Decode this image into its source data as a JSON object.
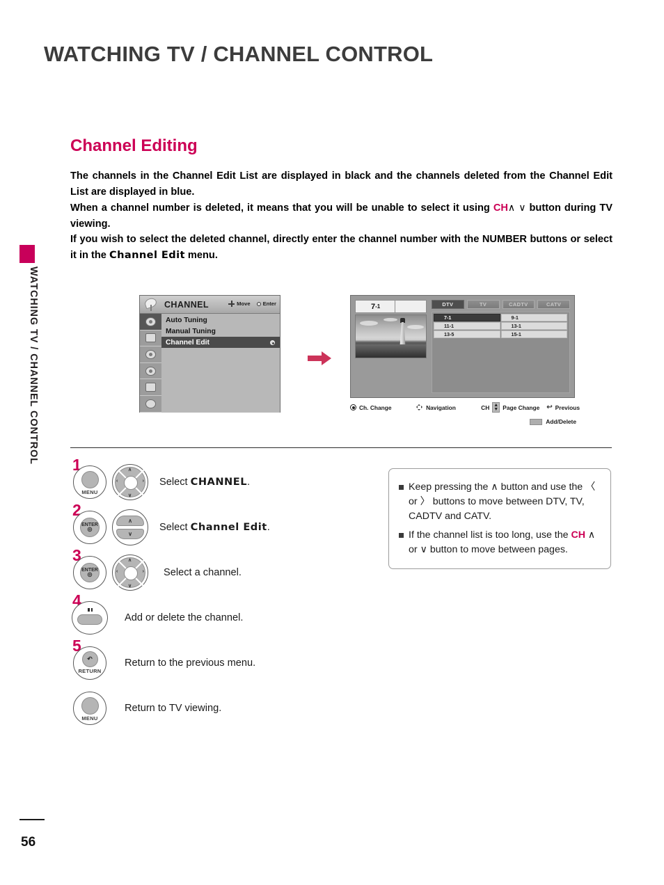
{
  "page": {
    "title": "WATCHING TV / CHANNEL CONTROL",
    "side_tab_text": "WATCHING TV / CHANNEL CONTROL",
    "number": "56",
    "accent_color": "#cc0055"
  },
  "section": {
    "heading": "Channel Editing",
    "paragraphs": {
      "p1_a": "The channels in the Channel Edit List are displayed in black and the channels deleted from the Channel Edit List are displayed in blue.",
      "p2_a": "When a channel number is deleted, it means that you will be unable to select it using ",
      "p2_ch": "CH",
      "p2_up": "∧",
      "p2_down": "∨",
      "p2_b": " button during TV viewing.",
      "p3_a": "If you wish to select the deleted channel, directly enter the channel number with the NUMBER buttons or select it in the ",
      "p3_emph": "Channel Edit",
      "p3_b": " menu."
    }
  },
  "osd_left": {
    "icon_name": "satellite-dish-icon",
    "title": "CHANNEL",
    "hint_move": "Move",
    "hint_enter": "Enter",
    "rail_icons": [
      "picture-icon",
      "screen-icon",
      "audio-icon",
      "time-icon",
      "option-icon",
      "lock-icon"
    ],
    "menu_items": [
      {
        "label": "Auto Tuning",
        "selected": false
      },
      {
        "label": "Manual Tuning",
        "selected": false
      },
      {
        "label": "Channel Edit",
        "selected": true
      }
    ]
  },
  "osd_right": {
    "preview_channel_major": "7",
    "preview_channel_minor": "-1",
    "tabs": [
      {
        "label": "DTV",
        "active": true
      },
      {
        "label": "TV",
        "active": false
      },
      {
        "label": "CADTV",
        "active": false
      },
      {
        "label": "CATV",
        "active": false
      }
    ],
    "channel_rows": [
      [
        {
          "label": "7-1",
          "highlight": true
        },
        {
          "label": "9-1",
          "highlight": false
        }
      ],
      [
        {
          "label": "11-1",
          "highlight": false
        },
        {
          "label": "13-1",
          "highlight": false
        }
      ],
      [
        {
          "label": "13-5",
          "highlight": false
        },
        {
          "label": "15-1",
          "highlight": false
        }
      ]
    ],
    "legend": [
      {
        "label": "Ch. Change",
        "icon": "enter-dot-icon"
      },
      {
        "label": "Navigation",
        "icon": "four-way-arrows-icon"
      },
      {
        "label": "Page Change",
        "icon": "ch-updown-icon",
        "prefix": "CH"
      },
      {
        "label": "Previous",
        "icon": "return-arrow-icon"
      }
    ],
    "legend_add_delete": "Add/Delete"
  },
  "steps": [
    {
      "number": "1",
      "buttons": [
        "menu-button",
        "four-way-wheel"
      ],
      "text_before": "Select ",
      "text_emph": "CHANNEL",
      "text_after": ".",
      "button_labels": {
        "primary": "MENU",
        "primary_cap": ""
      }
    },
    {
      "number": "2",
      "buttons": [
        "enter-button",
        "up-down-rocker"
      ],
      "text_before": "Select ",
      "text_emph": "Channel Edit",
      "text_after": ".",
      "button_labels": {
        "primary": "",
        "primary_cap": "ENTER"
      }
    },
    {
      "number": "3",
      "buttons": [
        "enter-button",
        "four-way-wheel"
      ],
      "text_before": "Select a channel.",
      "text_emph": "",
      "text_after": "",
      "button_labels": {
        "primary": "",
        "primary_cap": "ENTER"
      }
    },
    {
      "number": "4",
      "buttons": [
        "pill-button"
      ],
      "text_before": "Add or delete the channel.",
      "text_emph": "",
      "text_after": "",
      "button_labels": {
        "primary": "",
        "primary_cap": ""
      }
    },
    {
      "number": "5",
      "buttons": [
        "return-button"
      ],
      "text_before": "Return to the previous menu.",
      "text_emph": "",
      "text_after": "",
      "button_labels": {
        "primary": "RETURN",
        "primary_cap": "↶"
      }
    },
    {
      "number": "",
      "buttons": [
        "menu-button"
      ],
      "text_before": "Return to TV viewing.",
      "text_emph": "",
      "text_after": "",
      "button_labels": {
        "primary": "MENU",
        "primary_cap": ""
      }
    }
  ],
  "note_box": {
    "items": [
      {
        "a": "Keep pressing the ",
        "up": "∧",
        "b": " button and use the ",
        "left": "〈",
        "or": " or ",
        "right": "〉",
        "c": " buttons to move between DTV, TV, CADTV and CATV."
      },
      {
        "a": "If the channel list is too long, use the ",
        "ch": "CH",
        "up": "∧",
        "or": " or ",
        "down": "∨",
        "b": " button to move between pages."
      }
    ]
  }
}
